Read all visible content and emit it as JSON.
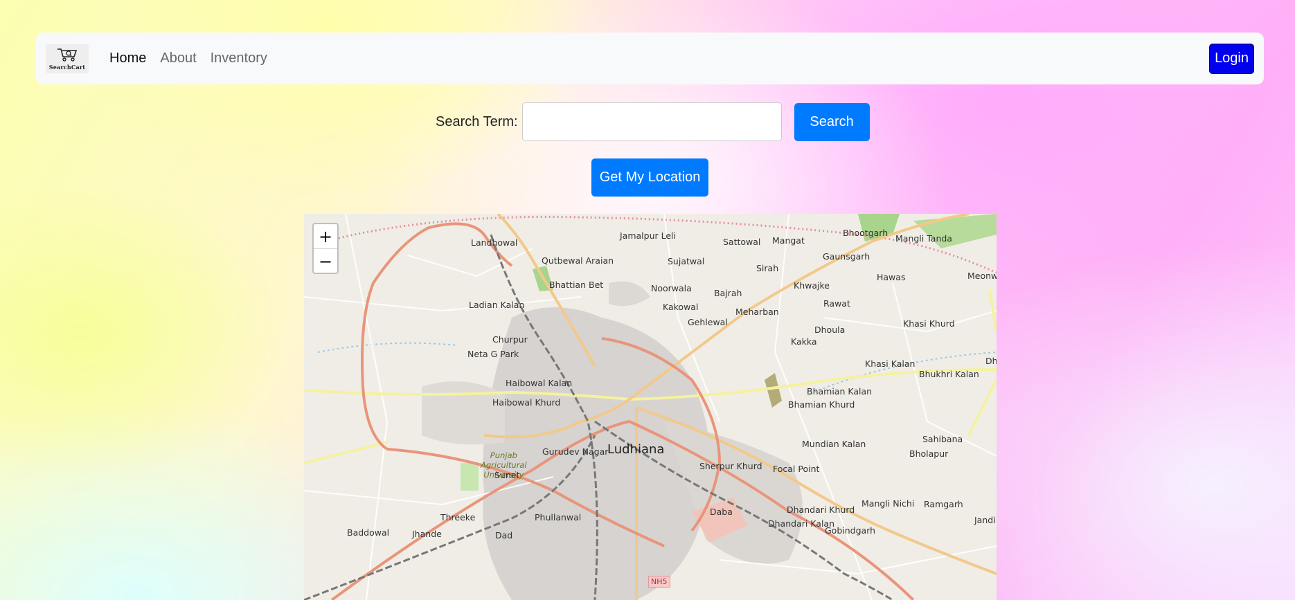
{
  "brand": {
    "logo_text": "SearchCart",
    "logo_icon": "shopping-cart-icon"
  },
  "nav": {
    "links": [
      {
        "label": "Home",
        "active": true
      },
      {
        "label": "About",
        "active": false
      },
      {
        "label": "Inventory",
        "active": false
      }
    ],
    "login_label": "Login"
  },
  "search": {
    "label": "Search Term:",
    "value": "",
    "placeholder": "",
    "button_label": "Search"
  },
  "location_button_label": "Get My Location",
  "map": {
    "zoom_in": "+",
    "zoom_out": "−",
    "city": "Ludhiana",
    "park": "Punjab Agricultural University",
    "park_lines": [
      "Punjab",
      "Agricultural",
      "University"
    ],
    "highway_shield": "NH5",
    "places": [
      "Landhowal",
      "Jamalpur Leli",
      "Sattowal",
      "Mangat",
      "Bhootgarh",
      "Mangli Tanda",
      "Qutbewal Araian",
      "Sujatwal",
      "Gaunsgarh",
      "Sirah",
      "Hawas",
      "Meonwal",
      "Bhattian Bet",
      "Noorwala",
      "Khwajke",
      "Bajrah",
      "Ladian Kalan",
      "Kakowal",
      "Meharban",
      "Rawat",
      "Gehlewal",
      "Khasi Khurd",
      "Dhoula",
      "Churpur",
      "Kakka",
      "Neta G Park",
      "Khasi Kalan",
      "Bhukhri Kalan",
      "Dh",
      "Haibowal Kalan",
      "Bhamian Kalan",
      "Haibowal Khurd",
      "Bhamian Khurd",
      "Sahibana",
      "Mundian Kalan",
      "Gurudev Nagar",
      "Bholapur",
      "Sherpur Khurd",
      "Focal Point",
      "Sunet",
      "Mangli Nichi",
      "Ramgarh",
      "Dhandari Khurd",
      "Threeke",
      "Phullanwal",
      "Daba",
      "Jandi",
      "Dhandari Kalan",
      "Gobindgarh",
      "Baddowal",
      "Jhande",
      "Dad"
    ]
  },
  "colors": {
    "primary": "#007bff",
    "login": "#0000ee",
    "navbar": "#f8f9fa",
    "trunk_road": "#e8957a",
    "secondary_road": "#f2c98a",
    "tertiary_road": "#f4f2a0",
    "rail": "#777777"
  }
}
